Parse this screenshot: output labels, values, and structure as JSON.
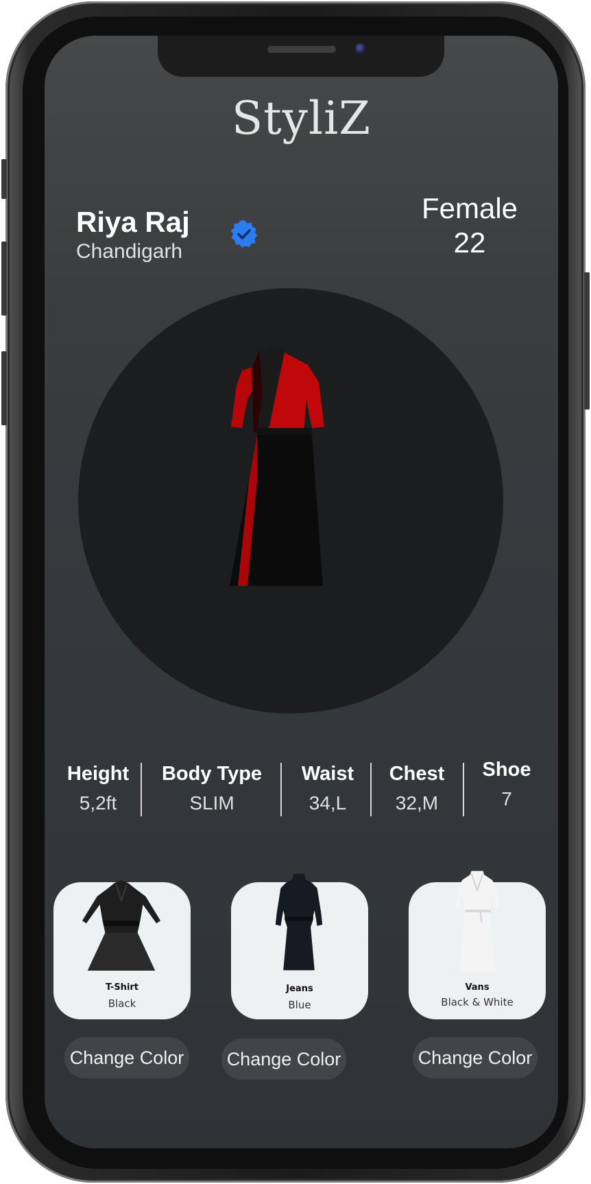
{
  "app": {
    "logo": "StyliZ"
  },
  "profile": {
    "name": "Riya Raj",
    "city": "Chandigarh",
    "gender": "Female",
    "age": "22",
    "verified_icon": "verified-badge-icon"
  },
  "measurements": [
    {
      "label": "Height",
      "value": "5,2ft"
    },
    {
      "label": "Body Type",
      "value": "SLIM"
    },
    {
      "label": "Waist",
      "value": "34,L"
    },
    {
      "label": "Chest",
      "value": "32,M"
    },
    {
      "label": "Shoe",
      "value": "7"
    }
  ],
  "outfits": [
    {
      "title": "T-Shirt",
      "color": "Black",
      "button": "Change Color"
    },
    {
      "title": "Jeans",
      "color": "Blue",
      "button": "Change Color"
    },
    {
      "title": "Vans",
      "color": "Black & White",
      "button": "Change Color"
    }
  ],
  "colors": {
    "screen_bg": "#3a3c3d",
    "circle_bg": "#1c1d1e",
    "card_bg": "#eef1f2",
    "badge_blue": "#2b7cf0",
    "accent_red": "#c0080a"
  }
}
